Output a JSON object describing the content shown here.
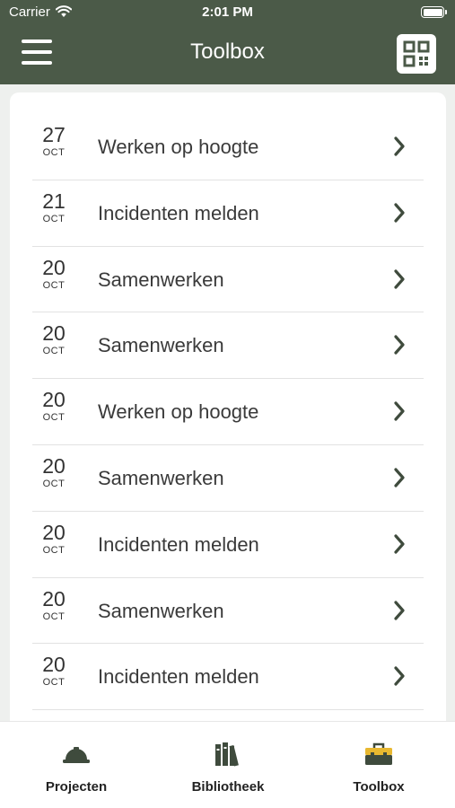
{
  "status": {
    "carrier": "Carrier",
    "time": "2:01 PM"
  },
  "nav": {
    "title": "Toolbox"
  },
  "items": [
    {
      "day": "27",
      "month": "OCT",
      "title": "Werken op hoogte"
    },
    {
      "day": "21",
      "month": "OCT",
      "title": "Incidenten melden"
    },
    {
      "day": "20",
      "month": "OCT",
      "title": "Samenwerken"
    },
    {
      "day": "20",
      "month": "OCT",
      "title": "Samenwerken"
    },
    {
      "day": "20",
      "month": "OCT",
      "title": "Werken op hoogte"
    },
    {
      "day": "20",
      "month": "OCT",
      "title": "Samenwerken"
    },
    {
      "day": "20",
      "month": "OCT",
      "title": "Incidenten melden"
    },
    {
      "day": "20",
      "month": "OCT",
      "title": "Samenwerken"
    },
    {
      "day": "20",
      "month": "OCT",
      "title": "Incidenten melden"
    }
  ],
  "tabs": [
    {
      "label": "Projecten",
      "icon": "hardhat-icon",
      "active": false
    },
    {
      "label": "Bibliotheek",
      "icon": "books-icon",
      "active": false
    },
    {
      "label": "Toolbox",
      "icon": "toolbox-icon",
      "active": true
    }
  ],
  "colors": {
    "header": "#4b5a48",
    "accent_active": "#e8b830",
    "icon_inactive": "#3f4b3d"
  }
}
